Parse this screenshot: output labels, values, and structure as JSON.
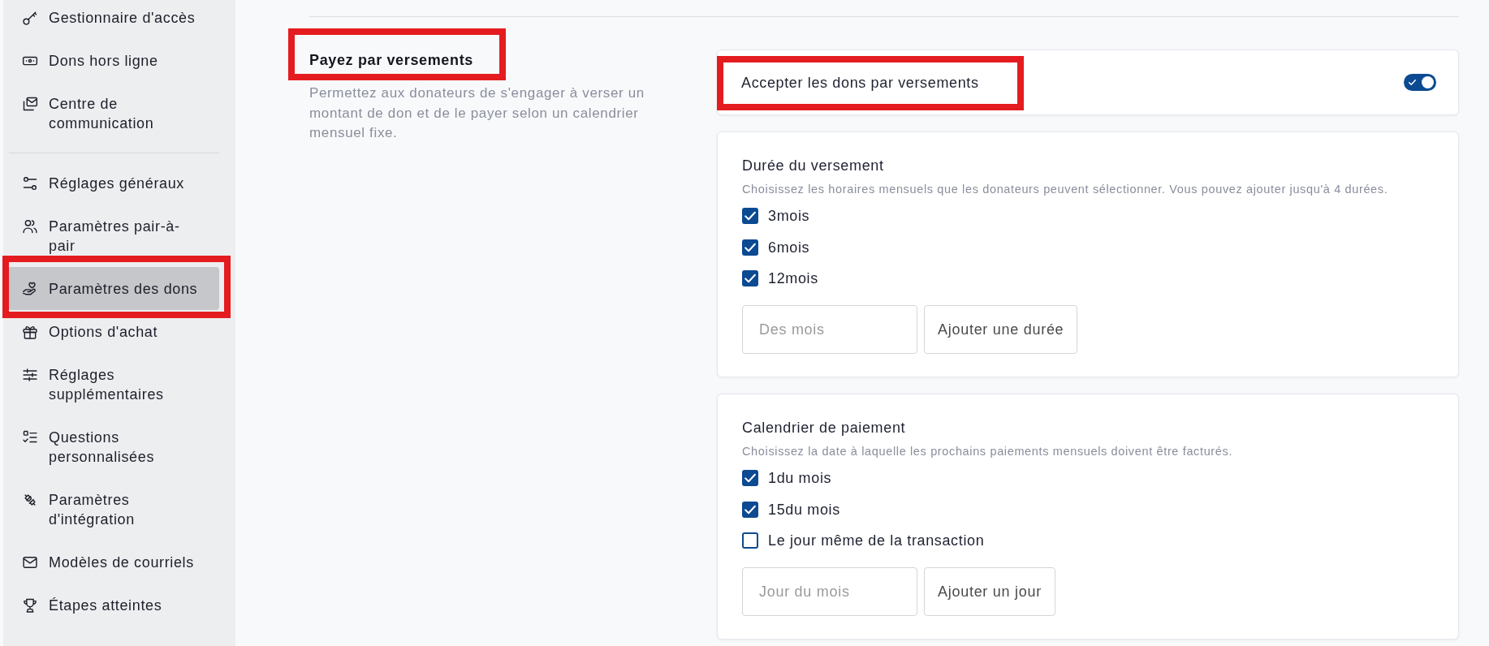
{
  "sidebar": {
    "groups": [
      {
        "items": [
          {
            "label": "Gestionnaire d'accès",
            "selected": false,
            "highlighted": false
          },
          {
            "label": "Dons hors ligne",
            "selected": false,
            "highlighted": false
          },
          {
            "label": "Centre de communication",
            "selected": false,
            "highlighted": false
          }
        ]
      },
      {
        "items": [
          {
            "label": "Réglages généraux",
            "selected": false,
            "highlighted": false
          },
          {
            "label": "Paramètres pair-à-pair",
            "selected": false,
            "highlighted": false
          },
          {
            "label": "Paramètres des dons",
            "selected": true,
            "highlighted": true
          },
          {
            "label": "Options d'achat",
            "selected": false,
            "highlighted": false
          },
          {
            "label": "Réglages supplémentaires",
            "selected": false,
            "highlighted": false
          },
          {
            "label": "Questions personnalisées",
            "selected": false,
            "highlighted": false
          },
          {
            "label": "Paramètres d'intégration",
            "selected": false,
            "highlighted": false
          },
          {
            "label": "Modèles de courriels",
            "selected": false,
            "highlighted": false
          },
          {
            "label": "Étapes atteintes",
            "selected": false,
            "highlighted": false
          }
        ]
      }
    ]
  },
  "section": {
    "title": "Payez par versements",
    "highlighted": true,
    "description": "Permettez aux donateurs de s'engager à verser un montant de don et de le payer selon un calendrier mensuel fixe."
  },
  "toggle_card": {
    "label": "Accepter les dons par versements",
    "highlighted": true,
    "on": true
  },
  "option_cards": [
    {
      "title": "Durée du versement",
      "hint": "Choisissez les horaires mensuels que les donateurs peuvent sélectionner. Vous pouvez ajouter jusqu'à 4 durées.",
      "options": [
        {
          "label": "3mois",
          "checked": true
        },
        {
          "label": "6mois",
          "checked": true
        },
        {
          "label": "12mois",
          "checked": true
        }
      ],
      "input": {
        "placeholder": "Des mois"
      },
      "button": "Ajouter une durée"
    },
    {
      "title": "Calendrier de paiement",
      "hint": "Choisissez la date à laquelle les prochains paiements mensuels doivent être facturés.",
      "options": [
        {
          "label": "1du mois",
          "checked": true
        },
        {
          "label": "15du mois",
          "checked": true
        },
        {
          "label": "Le jour même de la transaction",
          "checked": false
        }
      ],
      "input": {
        "placeholder": "Jour du mois"
      },
      "button": "Ajouter un jour"
    }
  ]
}
